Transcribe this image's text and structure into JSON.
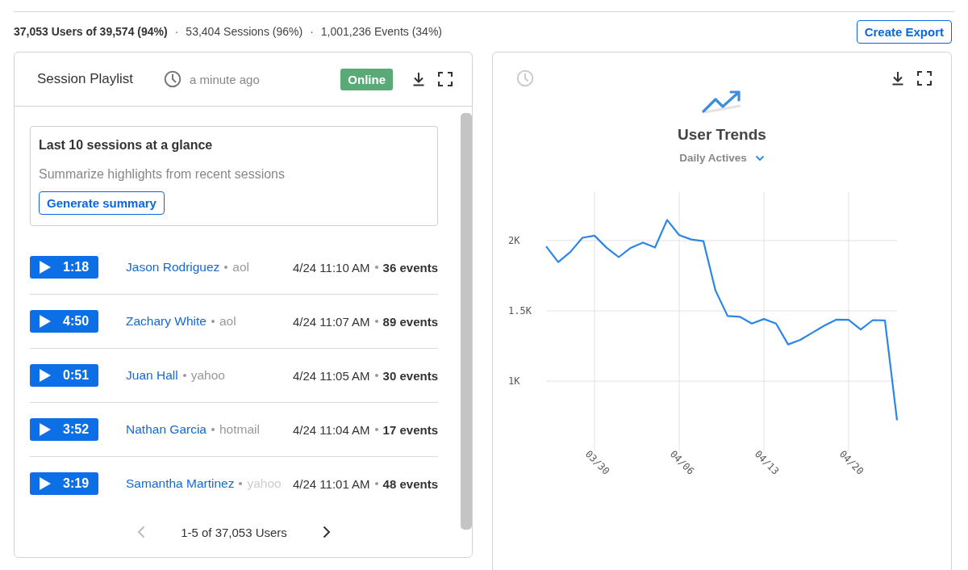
{
  "stats": [
    {
      "kind": "stat",
      "text": "37,053 Users of 39,574 (94%)",
      "bold": true
    },
    {
      "kind": "separator",
      "text": "·"
    },
    {
      "kind": "stat",
      "text": "53,404 Sessions (96%)",
      "bold": false
    },
    {
      "kind": "separator",
      "text": "·"
    },
    {
      "kind": "stat",
      "text": "1,001,236 Events (34%)",
      "bold": false
    }
  ],
  "export_button": "Create Export",
  "playlist": {
    "title": "Session Playlist",
    "updated": "a minute ago",
    "status": "Online",
    "online": true,
    "summary": {
      "title": "Last 10 sessions at a glance",
      "text": "Summarize highlights from recent sessions",
      "button": "Generate summary"
    },
    "sessions": [
      {
        "duration": "1:18",
        "name": "Jason Rodriguez",
        "provider": "aol",
        "time": "4/24 11:10 AM",
        "events": "36 events"
      },
      {
        "duration": "4:50",
        "name": "Zachary White",
        "provider": "aol",
        "time": "4/24 11:07 AM",
        "events": "89 events"
      },
      {
        "duration": "0:51",
        "name": "Juan Hall",
        "provider": "yahoo",
        "time": "4/24 11:05 AM",
        "events": "30 events"
      },
      {
        "duration": "3:52",
        "name": "Nathan Garcia",
        "provider": "hotmail",
        "time": "4/24 11:04 AM",
        "events": "17 events"
      },
      {
        "duration": "3:19",
        "name": "Samantha Martinez",
        "provider": "yahoo",
        "time": "4/24 11:01 AM",
        "events": "48 events"
      }
    ],
    "pagination": {
      "label": "1-5 of 37,053 Users",
      "prev_disabled": true,
      "next_disabled": false
    }
  },
  "trends": {
    "title": "User Trends",
    "metric": "Daily Actives",
    "chart_data": {
      "type": "line",
      "grid": true,
      "categories": [
        null,
        null,
        null,
        null,
        "03/30",
        null,
        null,
        null,
        null,
        null,
        null,
        "04/06",
        null,
        null,
        null,
        null,
        null,
        null,
        "04/13",
        null,
        null,
        null,
        null,
        null,
        null,
        "04/20",
        null,
        null,
        null,
        null
      ],
      "series": [
        {
          "color": "#2b86e8",
          "values": [
            1959,
            1847,
            1919,
            2020,
            2035,
            1949,
            1882,
            1949,
            1986,
            1951,
            2147,
            2039,
            2008,
            1996,
            1644,
            1463,
            1458,
            1409,
            1442,
            1409,
            1261,
            1293,
            1344,
            1395,
            1438,
            1436,
            1367,
            1434,
            1432,
            721
          ]
        }
      ],
      "ylim": [
        500,
        2350
      ],
      "yticks": [
        {
          "value": 1000,
          "label": "1K"
        },
        {
          "value": 1500,
          "label": "1.5K"
        },
        {
          "value": 2000,
          "label": "2K"
        }
      ]
    }
  }
}
